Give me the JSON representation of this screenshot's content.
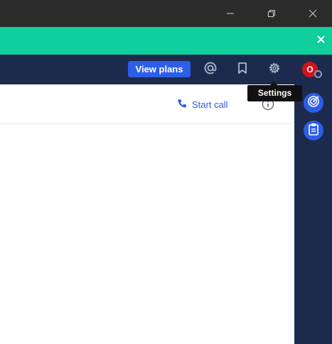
{
  "window": {
    "minimize_icon": "minimize-icon",
    "restore_icon": "restore-icon",
    "close_icon": "close-icon"
  },
  "banner": {
    "close_icon": "close-icon",
    "color": "#0fcf9c"
  },
  "topnav": {
    "view_plans_label": "View plans",
    "icons": [
      "mention-icon",
      "bookmark-icon",
      "settings-icon"
    ],
    "avatar_initial": "O",
    "avatar_color": "#d1141b",
    "bg_color": "#1c2b4d"
  },
  "tooltip": {
    "text": "Settings"
  },
  "header": {
    "start_call_label": "Start call",
    "phone_icon": "phone-icon",
    "info_icon": "info-icon",
    "accent": "#2d5ee8"
  },
  "rightbar": {
    "icons": [
      "target-icon",
      "clipboard-icon"
    ]
  }
}
